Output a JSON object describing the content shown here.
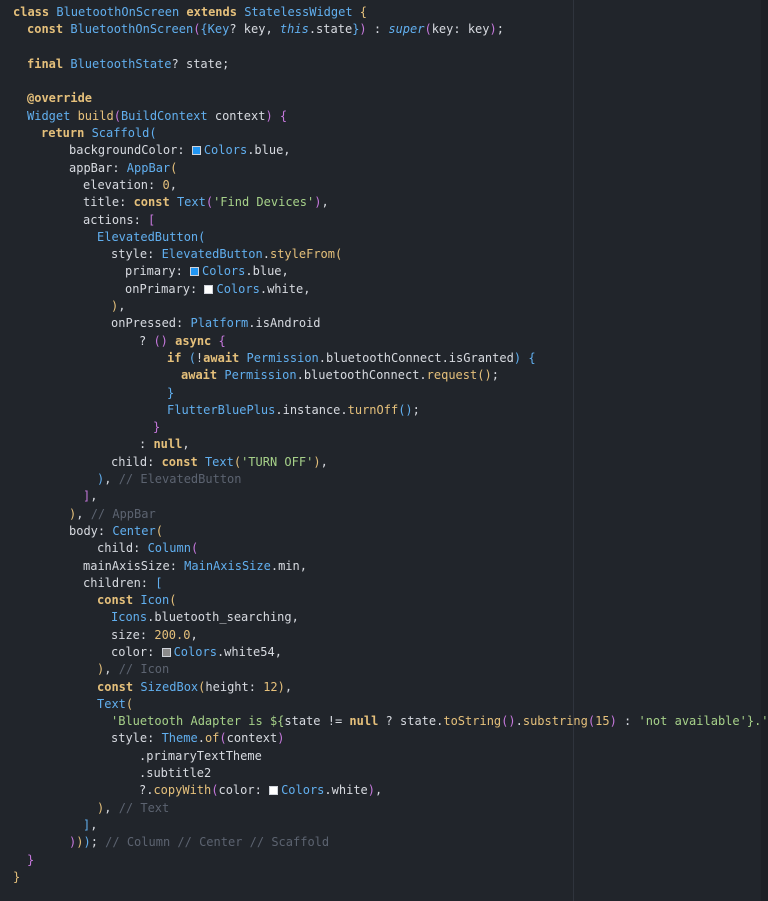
{
  "colors": {
    "blue_swatch": "#2196f3",
    "white_swatch": "#ffffff",
    "white54_swatch": "#8a8a8a"
  },
  "lines": [
    {
      "indent": 0,
      "tokens": [
        [
          "kw",
          "class "
        ],
        [
          "type",
          "BluetoothOnScreen "
        ],
        [
          "kw",
          "extends "
        ],
        [
          "type",
          "StatelessWidget "
        ],
        [
          "paren1",
          "{"
        ]
      ]
    },
    {
      "indent": 1,
      "tokens": [
        [
          "kw",
          "const "
        ],
        [
          "type",
          "BluetoothOnScreen"
        ],
        [
          "paren2",
          "("
        ],
        [
          "paren3",
          "{"
        ],
        [
          "type",
          "Key"
        ],
        [
          "plain",
          "? key, "
        ],
        [
          "italic",
          "this"
        ],
        [
          "plain",
          ".state"
        ],
        [
          "paren3",
          "}"
        ],
        [
          "paren2",
          ")"
        ],
        [
          "plain",
          " : "
        ],
        [
          "italic",
          "super"
        ],
        [
          "paren2",
          "("
        ],
        [
          "plain",
          "key: key"
        ],
        [
          "paren2",
          ")"
        ],
        [
          "plain",
          ";"
        ]
      ]
    },
    {
      "indent": 0,
      "tokens": []
    },
    {
      "indent": 1,
      "tokens": [
        [
          "kw",
          "final "
        ],
        [
          "type",
          "BluetoothState"
        ],
        [
          "plain",
          "? state;"
        ]
      ]
    },
    {
      "indent": 0,
      "tokens": []
    },
    {
      "indent": 1,
      "tokens": [
        [
          "kw",
          "@override"
        ]
      ]
    },
    {
      "indent": 1,
      "tokens": [
        [
          "type",
          "Widget "
        ],
        [
          "fn",
          "build"
        ],
        [
          "paren2",
          "("
        ],
        [
          "type",
          "BuildContext "
        ],
        [
          "plain",
          "context"
        ],
        [
          "paren2",
          ")"
        ],
        [
          "plain",
          " "
        ],
        [
          "paren2",
          "{"
        ]
      ]
    },
    {
      "indent": 2,
      "tokens": [
        [
          "kw",
          "return "
        ],
        [
          "type",
          "Scaffold"
        ],
        [
          "paren3",
          "("
        ]
      ]
    },
    {
      "indent": 4,
      "tokens": [
        [
          "plain",
          "backgroundColor: "
        ],
        [
          "swatch",
          "blue"
        ],
        [
          "type",
          "Colors"
        ],
        [
          "plain",
          ".blue,"
        ]
      ]
    },
    {
      "indent": 4,
      "tokens": [
        [
          "plain",
          "appBar: "
        ],
        [
          "type",
          "AppBar"
        ],
        [
          "paren1",
          "("
        ]
      ]
    },
    {
      "indent": 5,
      "tokens": [
        [
          "plain",
          "elevation: "
        ],
        [
          "num",
          "0"
        ],
        [
          "plain",
          ","
        ]
      ]
    },
    {
      "indent": 5,
      "tokens": [
        [
          "plain",
          "title: "
        ],
        [
          "kw",
          "const "
        ],
        [
          "type",
          "Text"
        ],
        [
          "paren2",
          "("
        ],
        [
          "str",
          "'Find Devices'"
        ],
        [
          "paren2",
          ")"
        ],
        [
          "plain",
          ","
        ]
      ]
    },
    {
      "indent": 5,
      "tokens": [
        [
          "plain",
          "actions: "
        ],
        [
          "paren2",
          "["
        ]
      ]
    },
    {
      "indent": 6,
      "tokens": [
        [
          "type",
          "ElevatedButton"
        ],
        [
          "paren3",
          "("
        ]
      ]
    },
    {
      "indent": 7,
      "tokens": [
        [
          "plain",
          "style: "
        ],
        [
          "type",
          "ElevatedButton"
        ],
        [
          "plain",
          "."
        ],
        [
          "fn",
          "styleFrom"
        ],
        [
          "paren1",
          "("
        ]
      ]
    },
    {
      "indent": 8,
      "tokens": [
        [
          "plain",
          "primary: "
        ],
        [
          "swatch",
          "blue"
        ],
        [
          "type",
          "Colors"
        ],
        [
          "plain",
          ".blue,"
        ]
      ]
    },
    {
      "indent": 8,
      "tokens": [
        [
          "plain",
          "onPrimary: "
        ],
        [
          "swatch",
          "white"
        ],
        [
          "type",
          "Colors"
        ],
        [
          "plain",
          ".white,"
        ]
      ]
    },
    {
      "indent": 7,
      "tokens": [
        [
          "paren1",
          ")"
        ],
        [
          "plain",
          ","
        ]
      ]
    },
    {
      "indent": 7,
      "tokens": [
        [
          "plain",
          "onPressed: "
        ],
        [
          "type",
          "Platform"
        ],
        [
          "plain",
          ".isAndroid"
        ]
      ]
    },
    {
      "indent": 9,
      "tokens": [
        [
          "plain",
          "? "
        ],
        [
          "paren2",
          "()"
        ],
        [
          "plain",
          " "
        ],
        [
          "kw",
          "async "
        ],
        [
          "paren2",
          "{"
        ]
      ]
    },
    {
      "indent": 11,
      "tokens": [
        [
          "kw",
          "if "
        ],
        [
          "paren3",
          "("
        ],
        [
          "plain",
          "!"
        ],
        [
          "kw",
          "await "
        ],
        [
          "type",
          "Permission"
        ],
        [
          "plain",
          ".bluetoothConnect.isGranted"
        ],
        [
          "paren3",
          ")"
        ],
        [
          "plain",
          " "
        ],
        [
          "paren3",
          "{"
        ]
      ]
    },
    {
      "indent": 12,
      "tokens": [
        [
          "kw",
          "await "
        ],
        [
          "type",
          "Permission"
        ],
        [
          "plain",
          ".bluetoothConnect."
        ],
        [
          "fn",
          "request"
        ],
        [
          "paren1",
          "()"
        ],
        [
          "plain",
          ";"
        ]
      ]
    },
    {
      "indent": 11,
      "tokens": [
        [
          "paren3",
          "}"
        ]
      ]
    },
    {
      "indent": 11,
      "tokens": [
        [
          "type",
          "FlutterBluePlus"
        ],
        [
          "plain",
          ".instance."
        ],
        [
          "fn",
          "turnOff"
        ],
        [
          "paren3",
          "()"
        ],
        [
          "plain",
          ";"
        ]
      ]
    },
    {
      "indent": 10,
      "tokens": [
        [
          "paren2",
          "}"
        ]
      ]
    },
    {
      "indent": 9,
      "tokens": [
        [
          "plain",
          ": "
        ],
        [
          "kw",
          "null"
        ],
        [
          "plain",
          ","
        ]
      ]
    },
    {
      "indent": 7,
      "tokens": [
        [
          "plain",
          "child: "
        ],
        [
          "kw",
          "const "
        ],
        [
          "type",
          "Text"
        ],
        [
          "paren1",
          "("
        ],
        [
          "str",
          "'TURN OFF'"
        ],
        [
          "paren1",
          ")"
        ],
        [
          "plain",
          ","
        ]
      ]
    },
    {
      "indent": 6,
      "tokens": [
        [
          "paren3",
          ")"
        ],
        [
          "plain",
          ", "
        ],
        [
          "comment",
          "// ElevatedButton"
        ]
      ]
    },
    {
      "indent": 5,
      "tokens": [
        [
          "paren2",
          "]"
        ],
        [
          "plain",
          ","
        ]
      ]
    },
    {
      "indent": 4,
      "tokens": [
        [
          "paren1",
          ")"
        ],
        [
          "plain",
          ", "
        ],
        [
          "comment",
          "// AppBar"
        ]
      ]
    },
    {
      "indent": 4,
      "tokens": [
        [
          "plain",
          "body: "
        ],
        [
          "type",
          "Center"
        ],
        [
          "paren1",
          "("
        ]
      ]
    },
    {
      "indent": 6,
      "tokens": [
        [
          "plain",
          "child: "
        ],
        [
          "type",
          "Column"
        ],
        [
          "paren2",
          "("
        ]
      ]
    },
    {
      "indent": 5,
      "tokens": [
        [
          "plain",
          "mainAxisSize: "
        ],
        [
          "type",
          "MainAxisSize"
        ],
        [
          "plain",
          ".min,"
        ]
      ]
    },
    {
      "indent": 5,
      "tokens": [
        [
          "plain",
          "children: "
        ],
        [
          "paren3",
          "["
        ]
      ]
    },
    {
      "indent": 6,
      "tokens": [
        [
          "kw",
          "const "
        ],
        [
          "type",
          "Icon"
        ],
        [
          "paren1",
          "("
        ]
      ]
    },
    {
      "indent": 7,
      "tokens": [
        [
          "type",
          "Icons"
        ],
        [
          "plain",
          ".bluetooth_searching,"
        ]
      ]
    },
    {
      "indent": 7,
      "tokens": [
        [
          "plain",
          "size: "
        ],
        [
          "num",
          "200.0"
        ],
        [
          "plain",
          ","
        ]
      ]
    },
    {
      "indent": 7,
      "tokens": [
        [
          "plain",
          "color: "
        ],
        [
          "swatch",
          "white54"
        ],
        [
          "type",
          "Colors"
        ],
        [
          "plain",
          ".white54,"
        ]
      ]
    },
    {
      "indent": 6,
      "tokens": [
        [
          "paren1",
          ")"
        ],
        [
          "plain",
          ", "
        ],
        [
          "comment",
          "// Icon"
        ]
      ]
    },
    {
      "indent": 6,
      "tokens": [
        [
          "kw",
          "const "
        ],
        [
          "type",
          "SizedBox"
        ],
        [
          "paren1",
          "("
        ],
        [
          "plain",
          "height: "
        ],
        [
          "num",
          "12"
        ],
        [
          "paren1",
          ")"
        ],
        [
          "plain",
          ","
        ]
      ]
    },
    {
      "indent": 6,
      "tokens": [
        [
          "type",
          "Text"
        ],
        [
          "paren1",
          "("
        ]
      ]
    },
    {
      "indent": 7,
      "tokens": [
        [
          "str",
          "'Bluetooth Adapter is ${"
        ],
        [
          "plain",
          "state != "
        ],
        [
          "kw",
          "null"
        ],
        [
          "plain",
          " ? state."
        ],
        [
          "fn",
          "toString"
        ],
        [
          "paren2",
          "()"
        ],
        [
          "plain",
          "."
        ],
        [
          "fn",
          "substring"
        ],
        [
          "paren2",
          "("
        ],
        [
          "num",
          "15"
        ],
        [
          "paren2",
          ")"
        ],
        [
          "plain",
          " : "
        ],
        [
          "str",
          "'not available'"
        ],
        [
          "str",
          "}.'"
        ],
        [
          "plain",
          ","
        ]
      ]
    },
    {
      "indent": 7,
      "tokens": [
        [
          "plain",
          "style: "
        ],
        [
          "type",
          "Theme"
        ],
        [
          "plain",
          "."
        ],
        [
          "fn",
          "of"
        ],
        [
          "paren2",
          "("
        ],
        [
          "plain",
          "context"
        ],
        [
          "paren2",
          ")"
        ]
      ]
    },
    {
      "indent": 9,
      "tokens": [
        [
          "plain",
          ".primaryTextTheme"
        ]
      ]
    },
    {
      "indent": 9,
      "tokens": [
        [
          "plain",
          ".subtitle2"
        ]
      ]
    },
    {
      "indent": 9,
      "tokens": [
        [
          "plain",
          "?."
        ],
        [
          "fn",
          "copyWith"
        ],
        [
          "paren2",
          "("
        ],
        [
          "plain",
          "color: "
        ],
        [
          "swatch",
          "white"
        ],
        [
          "type",
          "Colors"
        ],
        [
          "plain",
          ".white"
        ],
        [
          "paren2",
          ")"
        ],
        [
          "plain",
          ","
        ]
      ]
    },
    {
      "indent": 6,
      "tokens": [
        [
          "paren1",
          ")"
        ],
        [
          "plain",
          ", "
        ],
        [
          "comment",
          "// Text"
        ]
      ]
    },
    {
      "indent": 5,
      "tokens": [
        [
          "paren3",
          "]"
        ],
        [
          "plain",
          ","
        ]
      ]
    },
    {
      "indent": 4,
      "tokens": [
        [
          "paren2",
          ")"
        ],
        [
          "paren1",
          ")"
        ],
        [
          "paren3",
          ")"
        ],
        [
          "plain",
          "; "
        ],
        [
          "comment",
          "// Column // Center // Scaffold"
        ]
      ]
    },
    {
      "indent": 1,
      "tokens": [
        [
          "paren2",
          "}"
        ]
      ]
    },
    {
      "indent": 0,
      "tokens": [
        [
          "paren1",
          "}"
        ]
      ]
    }
  ]
}
